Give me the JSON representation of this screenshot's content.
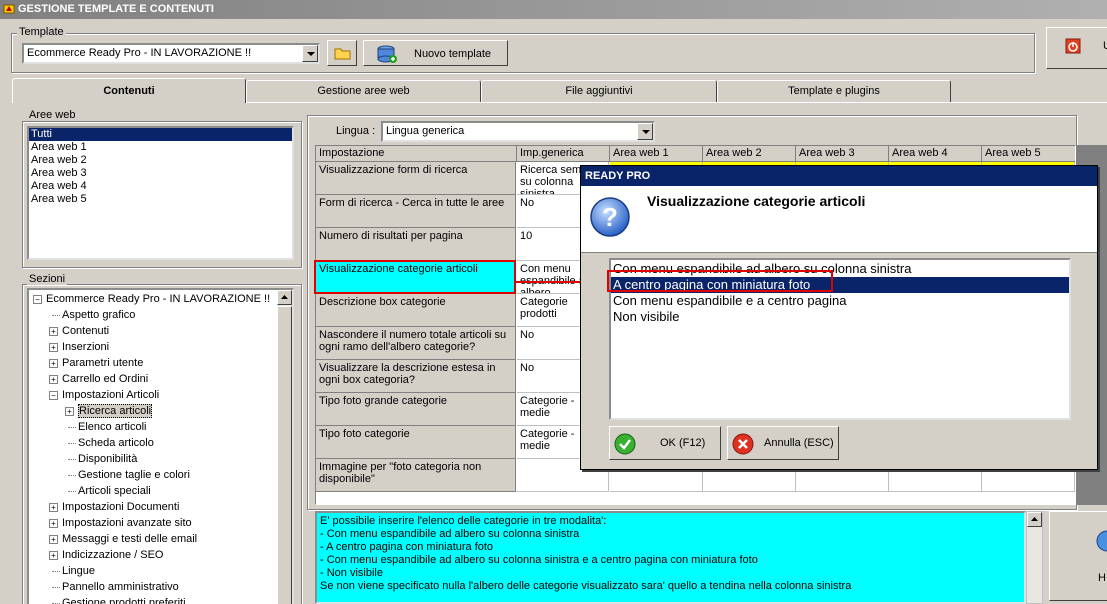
{
  "window": {
    "title": "GESTIONE TEMPLATE E CONTENUTI"
  },
  "template": {
    "group_label": "Template",
    "selected": "Ecommerce Ready Pro - IN LAVORAZIONE !!",
    "new_button": "Nuovo template"
  },
  "exit_button": {
    "label": "U"
  },
  "tabs": [
    {
      "label": "Contenuti",
      "active": true
    },
    {
      "label": "Gestione aree web"
    },
    {
      "label": "File aggiuntivi"
    },
    {
      "label": "Template e plugins"
    }
  ],
  "aree_web": {
    "label": "Aree web",
    "items": [
      "Tutti",
      "Area web 1",
      "Area web 2",
      "Area web 3",
      "Area web 4",
      "Area web 5"
    ]
  },
  "sezioni": {
    "label": "Sezioni",
    "root": "Ecommerce Ready Pro - IN LAVORAZIONE !!",
    "items": [
      {
        "label": "Aspetto grafico",
        "level": 1,
        "expand": false
      },
      {
        "label": "Contenuti",
        "level": 1,
        "expand": true
      },
      {
        "label": "Inserzioni",
        "level": 1,
        "expand": true
      },
      {
        "label": "Parametri utente",
        "level": 1,
        "expand": true
      },
      {
        "label": "Carrello ed Ordini",
        "level": 1,
        "expand": true
      },
      {
        "label": "Impostazioni Articoli",
        "level": 1,
        "expand": "open"
      },
      {
        "label": "Ricerca articoli",
        "level": 2,
        "expand": true,
        "selected": true
      },
      {
        "label": "Elenco articoli",
        "level": 2,
        "expand": false
      },
      {
        "label": "Scheda articolo",
        "level": 2,
        "expand": false
      },
      {
        "label": "Disponibilità",
        "level": 2,
        "expand": false
      },
      {
        "label": "Gestione taglie e colori",
        "level": 2,
        "expand": false
      },
      {
        "label": "Articoli speciali",
        "level": 2,
        "expand": false
      },
      {
        "label": "Impostazioni Documenti",
        "level": 1,
        "expand": true
      },
      {
        "label": "Impostazioni avanzate sito",
        "level": 1,
        "expand": true
      },
      {
        "label": "Messaggi e testi delle email",
        "level": 1,
        "expand": true
      },
      {
        "label": "Indicizzazione / SEO",
        "level": 1,
        "expand": true
      },
      {
        "label": "Lingue",
        "level": 1,
        "expand": false
      },
      {
        "label": "Pannello amministrativo",
        "level": 1,
        "expand": false
      },
      {
        "label": "Gestione prodotti preferiti",
        "level": 1,
        "expand": false
      }
    ]
  },
  "lingua": {
    "label": "Lingua :",
    "selected": "Lingua generica"
  },
  "grid": {
    "headers": [
      "Impostazione",
      "Imp.generica",
      "Area web 1",
      "Area web 2",
      "Area web 3",
      "Area web 4",
      "Area web 5"
    ],
    "rows": [
      {
        "name": "Visualizzazione form di ricerca",
        "value": "Ricerca semplice su colonna sinistra"
      },
      {
        "name": "Form di ricerca - Cerca in tutte le aree",
        "value": "No"
      },
      {
        "name": "Numero di risultati per pagina",
        "value": "10"
      },
      {
        "name": "Visualizzazione categorie articoli",
        "value": "Con menu espandibile ad albero",
        "highlight": true
      },
      {
        "name": "Descrizione box categorie",
        "value": "Categorie prodotti"
      },
      {
        "name": "Nascondere il numero totale articoli su ogni ramo dell'albero categorie?",
        "value": "No"
      },
      {
        "name": "Visualizzare la descrizione estesa in ogni box categoria?",
        "value": "No"
      },
      {
        "name": "Tipo foto grande categorie",
        "value": "Categorie - medie"
      },
      {
        "name": "Tipo foto categorie",
        "value": "Categorie - medie"
      },
      {
        "name": "Immagine per \"foto categoria non disponibile\"",
        "value": ""
      }
    ]
  },
  "description": {
    "lines": [
      "E' possibile inserire l'elenco delle categorie in tre modalita':",
      "- Con menu espandibile ad albero su colonna sinistra",
      "- A centro pagina con miniatura foto",
      "- Con menu espandibile ad albero su colonna sinistra e a centro pagina con miniatura foto",
      "- Non visibile",
      "Se non viene specificato nulla l'albero delle categorie visualizzato sara' quello a tendina nella colonna sinistra"
    ]
  },
  "right_button": {
    "label": "H"
  },
  "dialog": {
    "title": "READY PRO",
    "question": "Visualizzazione categorie articoli",
    "options": [
      "Con menu espandibile ad albero su colonna sinistra",
      "A centro pagina con miniatura foto",
      "Con menu espandibile e a centro pagina",
      "Non visibile"
    ],
    "selected_index": 1,
    "ok_label": "OK (F12)",
    "cancel_label": "Annulla (ESC)"
  },
  "colors": {
    "selection": "#0a246a",
    "highlight": "#00ffff",
    "annotation": "#e00000",
    "yellow": "#ffff00"
  }
}
